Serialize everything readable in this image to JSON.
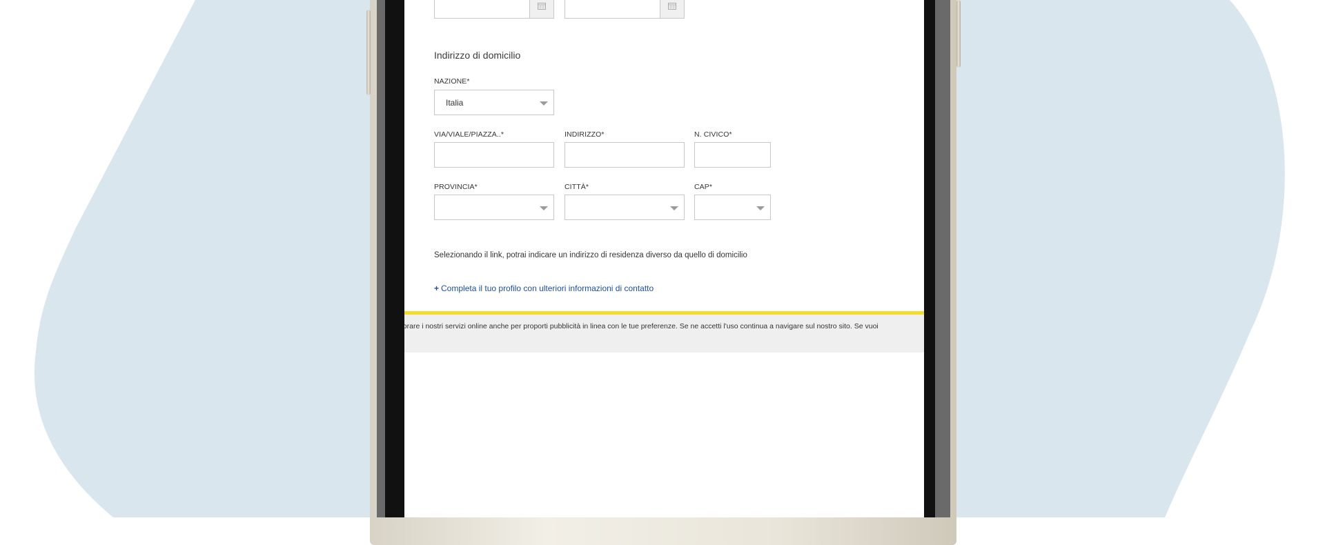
{
  "form": {
    "section_title": "Indirizzo di domicilio",
    "nazione": {
      "label": "NAZIONE*",
      "value": "Italia"
    },
    "via": {
      "label": "VIA/VIALE/PIAZZA..*",
      "value": ""
    },
    "indirizzo": {
      "label": "INDIRIZZO*",
      "value": ""
    },
    "civico": {
      "label": "N. CIVICO*",
      "value": ""
    },
    "provincia": {
      "label": "PROVINCIA*",
      "value": ""
    },
    "citta": {
      "label": "CITTÀ*",
      "value": ""
    },
    "cap": {
      "label": "CAP*",
      "value": ""
    },
    "info_text": "Selezionando il link, potrai indicare un indirizzo di residenza diverso da quello di domicilio",
    "link_plus": "+",
    "link_text": "Completa il tuo profilo con ulteriori informazioni di contatto"
  },
  "cookie": {
    "text": "ano a migliorare i nostri servizi online anche per proporti pubblicità in linea con le tue preferenze. Se ne accetti l'uso continua a navigare sul nostro sito. Se vuoi"
  },
  "colors": {
    "background_blob": "#dae6ed",
    "link": "#1f4f96",
    "cookie_border": "#f3dc2c",
    "cookie_bg": "#efefef"
  }
}
